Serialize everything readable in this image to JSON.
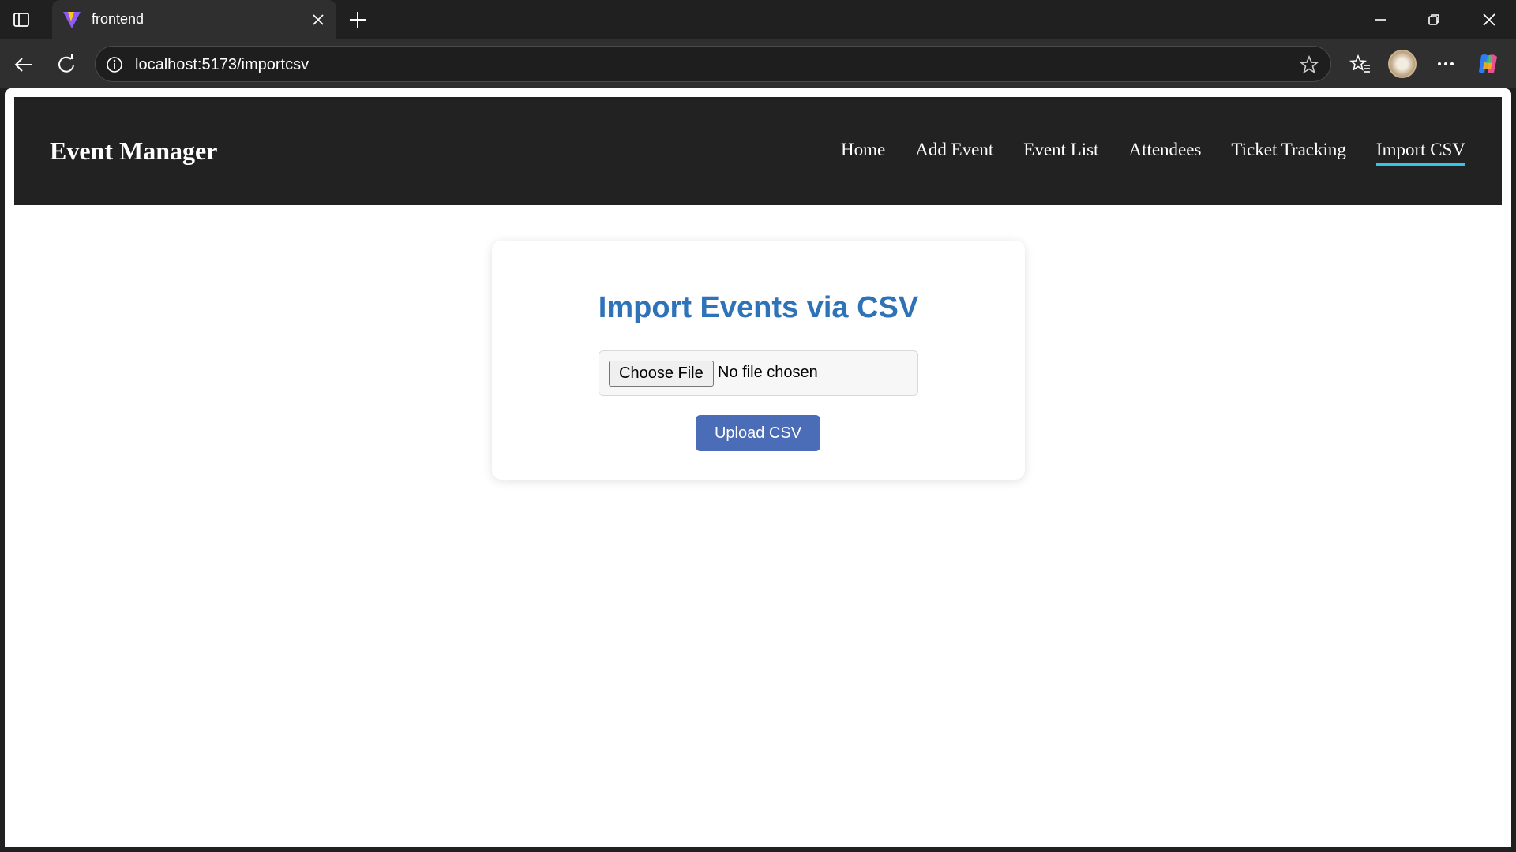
{
  "browser": {
    "tab_title": "frontend",
    "url": "localhost:5173/importcsv"
  },
  "site": {
    "brand": "Event Manager",
    "nav": [
      {
        "label": "Home"
      },
      {
        "label": "Add Event"
      },
      {
        "label": "Event List"
      },
      {
        "label": "Attendees"
      },
      {
        "label": "Ticket Tracking"
      },
      {
        "label": "Import CSV",
        "active": true
      }
    ],
    "accent_color": "#35c3e8"
  },
  "import_card": {
    "title": "Import Events via CSV",
    "title_color": "#2e72b8",
    "choose_file_label": "Choose File",
    "file_status": "No file chosen",
    "upload_label": "Upload CSV",
    "upload_color": "#4b6cb7"
  }
}
